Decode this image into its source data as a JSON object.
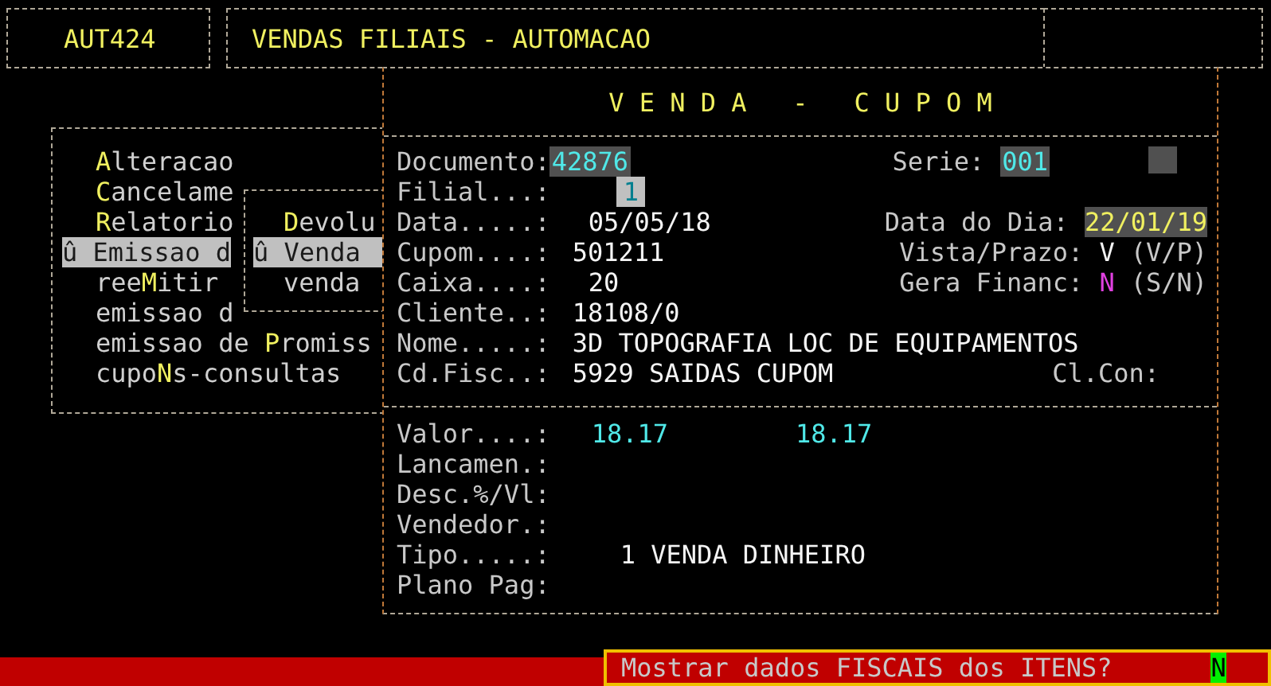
{
  "header": {
    "code": "AUT424",
    "title": "VENDAS FILIAIS - AUTOMACAO"
  },
  "menu": {
    "items": [
      {
        "hotkey": "A",
        "after": "lteracao",
        "selected": false
      },
      {
        "hotkey": "C",
        "after": "ancelame",
        "selected": false
      },
      {
        "hotkey": "R",
        "after": "elatorio",
        "selected": false
      },
      {
        "before": "û Emissao d",
        "selected": true
      },
      {
        "before": "ree",
        "hotkey": "M",
        "after": "itir",
        "selected": false
      },
      {
        "before": "emissao d",
        "selected": false
      },
      {
        "before": "emissao de ",
        "hotkey": "P",
        "after": "romiss",
        "selected": false
      },
      {
        "before": "cupo",
        "hotkey": "N",
        "after": "s-consultas",
        "selected": false
      }
    ]
  },
  "submenu": {
    "items": [
      {
        "hotkey": "D",
        "after": "evolu",
        "selected": false
      },
      {
        "before": "û Venda",
        "selected": true
      },
      {
        "before": "venda",
        "selected": false
      }
    ]
  },
  "venda": {
    "title": "V E N D A   -   C U P O M",
    "fields": [
      {
        "label": "Documento:",
        "value": "42876",
        "kind": "input",
        "right": {
          "label": "Serie:",
          "value": "001",
          "kind": "input"
        }
      },
      {
        "label": "Filial...:",
        "value": "1",
        "kind": "cursor"
      },
      {
        "label": "Data.....:",
        "value": "05/05/18",
        "kind": "plain",
        "right": {
          "label": "Data do Dia:",
          "value": "22/01/19",
          "kind": "date"
        }
      },
      {
        "label": "Cupom....:",
        "value": "501211",
        "kind": "plain",
        "right": {
          "label": "Vista/Prazo:",
          "value": "V",
          "kind": "plain",
          "hint": "(V/P)"
        }
      },
      {
        "label": "Caixa....:",
        "value": "20",
        "kind": "plain",
        "right": {
          "label": "Gera Financ:",
          "value": "N",
          "kind": "flag",
          "hint": "(S/N)"
        }
      },
      {
        "label": "Cliente..:",
        "value": "18108/0",
        "kind": "plain"
      },
      {
        "label": "Nome.....:",
        "value": "3D TOPOGRAFIA LOC DE EQUIPAMENTOS",
        "kind": "plain"
      },
      {
        "label": "Cd.Fisc..:",
        "value": "5929 SAIDAS CUPOM",
        "kind": "plain",
        "right": {
          "label": "Cl.Con:"
        }
      }
    ],
    "totals": [
      {
        "label": "Valor....:",
        "values": [
          "18.17",
          "18.17"
        ]
      },
      {
        "label": "Lancamen.:"
      },
      {
        "label": "Desc.%/Vl:"
      },
      {
        "label": "Vendedor.:"
      },
      {
        "label": "Tipo.....:",
        "value": "1 VENDA DINHEIRO"
      },
      {
        "label": "Plano Pag:"
      }
    ]
  },
  "prompt": {
    "question": "Mostrar dados FISCAIS dos ITENS?",
    "answer": "N"
  }
}
